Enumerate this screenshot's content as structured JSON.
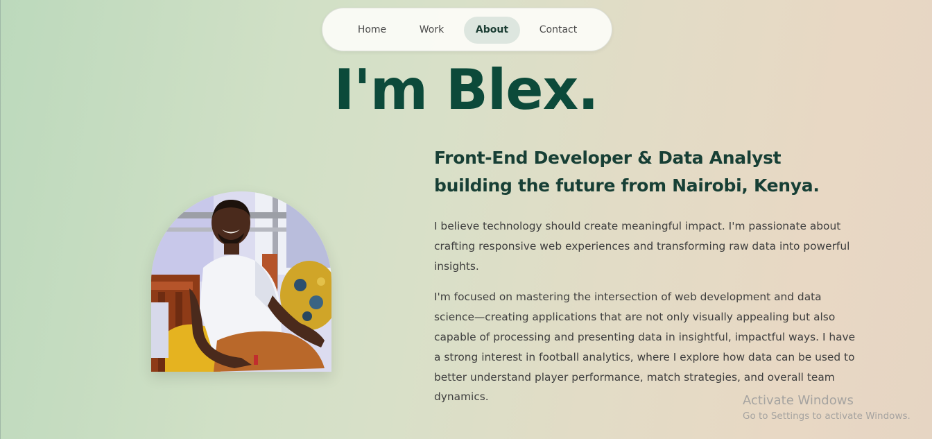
{
  "nav": {
    "items": [
      {
        "label": "Home"
      },
      {
        "label": "Work"
      },
      {
        "label": "About",
        "active": true
      },
      {
        "label": "Contact"
      }
    ]
  },
  "hero": {
    "title": "I'm Blex."
  },
  "about": {
    "subtitle_line1": "Front-End Developer & Data Analyst",
    "subtitle_line2": "building the future from Nairobi, Kenya.",
    "paragraph1": "I believe technology should create meaningful impact. I'm passionate about crafting responsive web experiences and transforming raw data into powerful insights.",
    "paragraph2": "I'm focused on mastering the intersection of web development and data science—creating applications that are not only visually appealing but also capable of processing and presenting data in insightful, impactful ways. I have a strong interest in football analytics, where I explore how data can be used to better understand player performance, match strategies, and overall team dynamics."
  },
  "watermark": {
    "line1": "Activate Windows",
    "line2": "Go to Settings to activate Windows."
  },
  "colors": {
    "accent": "#0c4a3a",
    "nav_active_bg": "#dde6df"
  }
}
